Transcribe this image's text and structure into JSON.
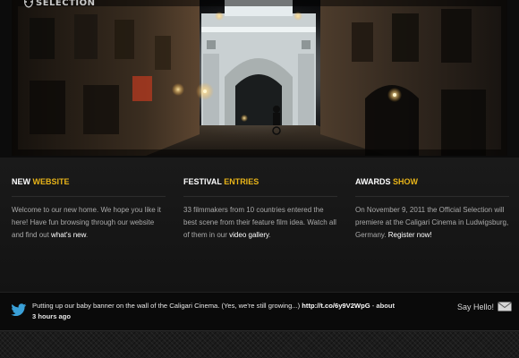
{
  "header": {
    "logo_text": "SELECTION"
  },
  "columns": [
    {
      "title_plain": "NEW",
      "title_accent": "WEBSITE",
      "body": "Welcome to our new home. We hope you like it here! Have fun browsing through our website and find out ",
      "link": "what's new",
      "body_after": "."
    },
    {
      "title_plain": "FESTIVAL",
      "title_accent": "ENTRIES",
      "body": "33 filmmakers from 10 countries entered the best scene from their feature film idea. Watch all of them in our ",
      "link": "video gallery",
      "body_after": "."
    },
    {
      "title_plain": "AWARDS",
      "title_accent": "SHOW",
      "body": "On November 9, 2011 the Official Selection will premiere at the Caligari Cinema in Ludwigsburg, Germany. ",
      "link": "Register now!",
      "body_after": ""
    }
  ],
  "twitter": {
    "text": "Putting up our baby banner on the wall of the Caligari Cinema. (Yes, we're still growing...) ",
    "link": "http://t.co/6y9V2WpG",
    "separator": " - ",
    "time": "about 3 hours ago"
  },
  "contact": {
    "label": "Say Hello!"
  },
  "colors": {
    "accent": "#e8b419",
    "background": "#151515",
    "text": "#a9a9a9"
  }
}
